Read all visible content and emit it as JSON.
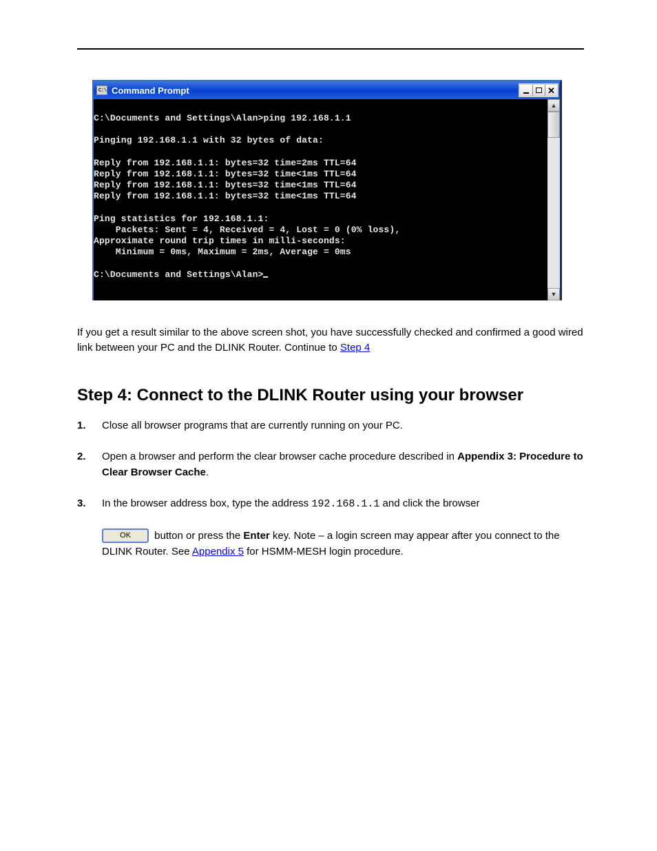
{
  "cmd_window": {
    "title": "Command Prompt",
    "app_icon_text": "C:\\",
    "lines": "C:\\Documents and Settings\\Alan>ping 192.168.1.1\n\nPinging 192.168.1.1 with 32 bytes of data:\n\nReply from 192.168.1.1: bytes=32 time=2ms TTL=64\nReply from 192.168.1.1: bytes=32 time<1ms TTL=64\nReply from 192.168.1.1: bytes=32 time<1ms TTL=64\nReply from 192.168.1.1: bytes=32 time<1ms TTL=64\n\nPing statistics for 192.168.1.1:\n    Packets: Sent = 4, Received = 4, Lost = 0 (0% loss),\nApproximate round trip times in milli-seconds:\n    Minimum = 0ms, Maximum = 2ms, Average = 0ms\n\nC:\\Documents and Settings\\Alan>"
  },
  "para1": {
    "lead": "If you get a result similar to the above screen shot, you have successfully checked and confirmed a good wired link between your PC and the DLINK Router.  Continue to ",
    "link": "Step 4",
    "tail": ""
  },
  "heading": "Step 4: Connect to the DLINK Router using your browser",
  "steps": {
    "s1": "Close all browser programs that are currently running on your PC.",
    "s2": {
      "a": "Open a browser and perform the clear browser cache procedure described in ",
      "b": "Appendix 3: Procedure to Clear Browser Cache",
      "c": "."
    },
    "s3": {
      "a": "In the browser address box, type the address ",
      "addr": "192.168.1.1",
      "b": " and click the browser"
    },
    "s4": {
      "ok_label": "OK",
      "a": " button or press the ",
      "enter_key": "Enter",
      "b": " key.  Note – a login screen may appear after you connect to the DLINK Router.  See ",
      "link": "Appendix 5",
      "c": " for HSMM-MESH login procedure."
    }
  }
}
